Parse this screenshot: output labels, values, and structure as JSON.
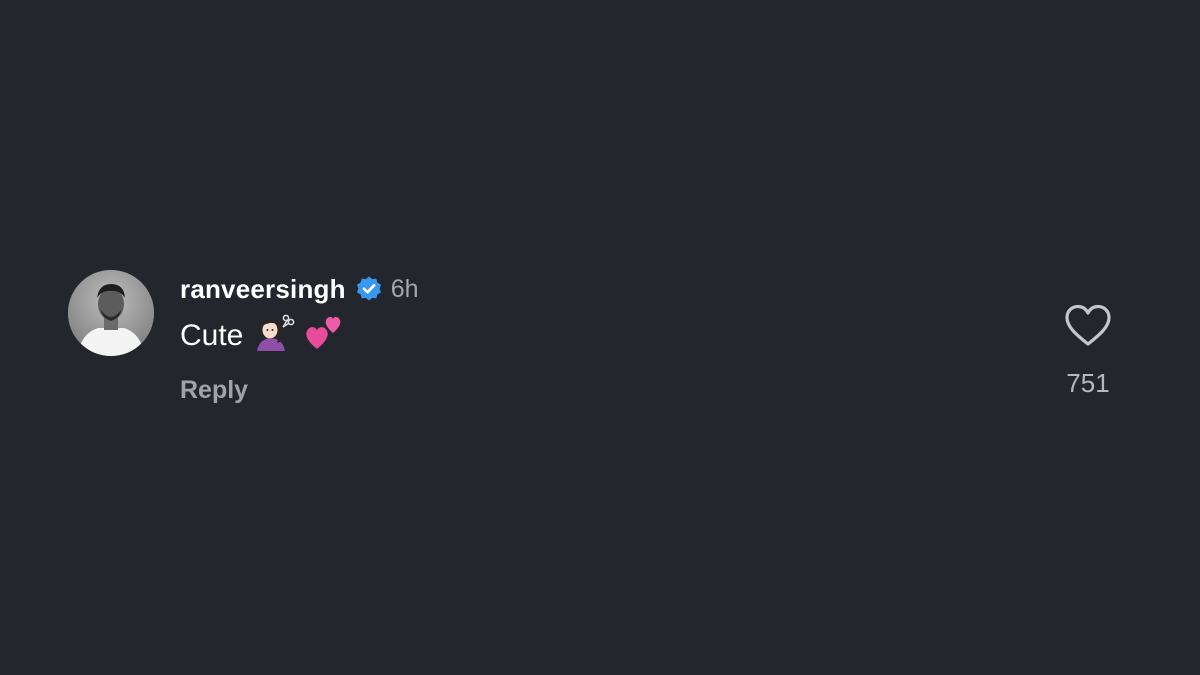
{
  "comment": {
    "username": "ranveersingh",
    "timestamp": "6h",
    "text": "Cute",
    "reply_label": "Reply",
    "like_count": "751",
    "verified": true
  },
  "colors": {
    "background": "#24262d",
    "verified_badge": "#3897f0",
    "secondary_text": "#a3a7b0"
  },
  "icons": {
    "verified": "verified-badge-icon",
    "like": "heart-outline-icon",
    "emoji_1": "woman-getting-haircut-emoji",
    "emoji_2": "two-hearts-emoji"
  }
}
